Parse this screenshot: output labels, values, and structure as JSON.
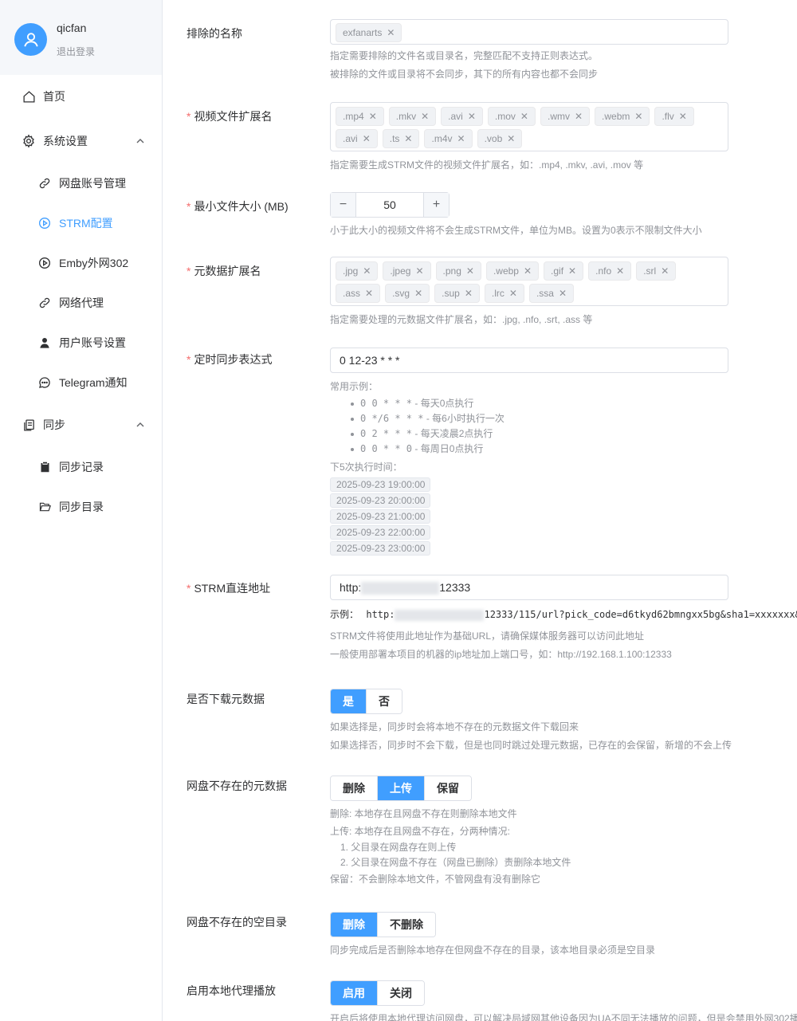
{
  "user": {
    "name": "qicfan",
    "logout": "退出登录"
  },
  "menu": {
    "home": "首页",
    "settings": "系统设置",
    "settings_items": [
      "网盘账号管理",
      "STRM配置",
      "Emby外网302",
      "网络代理",
      "用户账号设置",
      "Telegram通知"
    ],
    "sync": "同步",
    "sync_items": [
      "同步记录",
      "同步目录"
    ]
  },
  "colors": {
    "accent": "#409eff",
    "required": "#f56c6c",
    "muted": "#909399"
  },
  "form": {
    "exclude": {
      "label": "排除的名称",
      "tags": [
        "exfanarts"
      ],
      "help1": "指定需要排除的文件名或目录名，完整匹配不支持正则表达式。",
      "help2": "被排除的文件或目录将不会同步，其下的所有内容也都不会同步"
    },
    "video_ext": {
      "required": "*",
      "label": "视频文件扩展名",
      "tags": [
        ".mp4",
        ".mkv",
        ".avi",
        ".mov",
        ".wmv",
        ".webm",
        ".flv",
        ".avi",
        ".ts",
        ".m4v",
        ".vob"
      ],
      "help": "指定需要生成STRM文件的视频文件扩展名，如：.mp4, .mkv, .avi, .mov 等"
    },
    "min_size": {
      "required": "*",
      "label": "最小文件大小 (MB)",
      "value": "50",
      "minus": "−",
      "plus": "+",
      "help": "小于此大小的视频文件将不会生成STRM文件，单位为MB。设置为0表示不限制文件大小"
    },
    "meta_ext": {
      "required": "*",
      "label": "元数据扩展名",
      "tags": [
        ".jpg",
        ".jpeg",
        ".png",
        ".webp",
        ".gif",
        ".nfo",
        ".srl",
        ".ass",
        ".svg",
        ".sup",
        ".lrc",
        ".ssa"
      ],
      "help": "指定需要处理的元数据文件扩展名，如：.jpg, .nfo, .srt, .ass 等"
    },
    "cron": {
      "required": "*",
      "label": "定时同步表达式",
      "value": "0 12-23 * * *",
      "examples_title": "常用示例：",
      "examples": [
        {
          "expr": "0 0 * * *",
          "desc": " - 每天0点执行"
        },
        {
          "expr": "0 */6 * * *",
          "desc": " - 每6小时执行一次"
        },
        {
          "expr": "0 2 * * *",
          "desc": " - 每天凌晨2点执行"
        },
        {
          "expr": "0 0 * * 0",
          "desc": " - 每周日0点执行"
        }
      ],
      "next_title": "下5次执行时间：",
      "next_times": [
        "2025-09-23 19:00:00",
        "2025-09-23 20:00:00",
        "2025-09-23 21:00:00",
        "2025-09-23 22:00:00",
        "2025-09-23 23:00:00"
      ]
    },
    "strm_url": {
      "required": "*",
      "label": "STRM直连地址",
      "value_prefix": "http:",
      "value_suffix": "12333",
      "example_label": "示例：",
      "example_prefix": "http:",
      "example_suffix": "12333/115/url?pick_code=d6tkyd62bmngxx5bg&sha1=xxxxxxx&",
      "help1": "STRM文件将使用此地址作为基础URL，请确保媒体服务器可以访问此地址",
      "help2": "一般使用部署本项目的机器的ip地址加上端口号，如：http://192.168.1.100:12333"
    },
    "download_meta": {
      "label": "是否下载元数据",
      "options": [
        "是",
        "否"
      ],
      "selected": "是",
      "help1": "如果选择是，同步时会将本地不存在的元数据文件下载回来",
      "help2": "如果选择否，同步时不会下载，但是也同时跳过处理元数据，已存在的会保留，新增的不会上传"
    },
    "missing_meta": {
      "label": "网盘不存在的元数据",
      "options": [
        "删除",
        "上传",
        "保留"
      ],
      "selected": "上传",
      "help1": "删除: 本地存在且网盘不存在则删除本地文件",
      "help2": "上传: 本地存在且网盘不存在，分两种情况:",
      "help_items": [
        "1. 父目录在网盘存在则上传",
        "2. 父目录在网盘不存在（网盘已删除）责删除本地文件"
      ],
      "help3": "保留：不会删除本地文件，不管网盘有没有删除它"
    },
    "empty_dir": {
      "label": "网盘不存在的空目录",
      "options": [
        "删除",
        "不删除"
      ],
      "selected": "删除",
      "help": "同步完成后是否删除本地存在但网盘不存在的目录，该本地目录必须是空目录"
    },
    "local_proxy": {
      "label": "启用本地代理播放",
      "options": [
        "启用",
        "关闭"
      ],
      "selected": "启用",
      "help": "开启后将使用本地代理访问网盘，可以解决局域网其他设备因为UA不同无法播放的问题，但是会禁用外网302播"
    }
  }
}
